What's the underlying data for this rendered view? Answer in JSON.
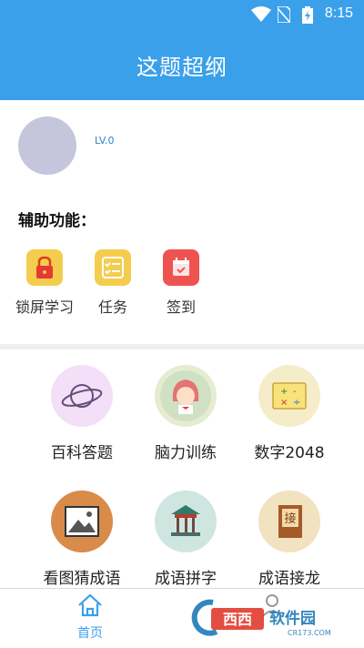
{
  "status": {
    "time": "8:15"
  },
  "header": {
    "title": "这题超纲"
  },
  "profile": {
    "level": "LV.0"
  },
  "aux": {
    "title": "辅助功能：",
    "items": [
      {
        "label": "锁屏学习",
        "icon": "lock-icon",
        "color": "#f2c94c"
      },
      {
        "label": "任务",
        "icon": "task-icon",
        "color": "#f2c94c"
      },
      {
        "label": "签到",
        "icon": "calendar-icon",
        "color": "#ef5350"
      }
    ]
  },
  "grid": {
    "items": [
      {
        "label": "百科答题",
        "icon": "planet-icon"
      },
      {
        "label": "脑力训练",
        "icon": "brain-girl-icon"
      },
      {
        "label": "数字2048",
        "icon": "math-board-icon"
      },
      {
        "label": "看图猜成语",
        "icon": "picture-icon"
      },
      {
        "label": "成语拼字",
        "icon": "pavilion-icon"
      },
      {
        "label": "成语接龙",
        "icon": "book-icon"
      }
    ]
  },
  "bottom_nav": {
    "home_label": "首页"
  },
  "watermark": {
    "text": "西西软件园",
    "url": "CR173.COM"
  },
  "colors": {
    "primary": "#3aa0ea"
  }
}
